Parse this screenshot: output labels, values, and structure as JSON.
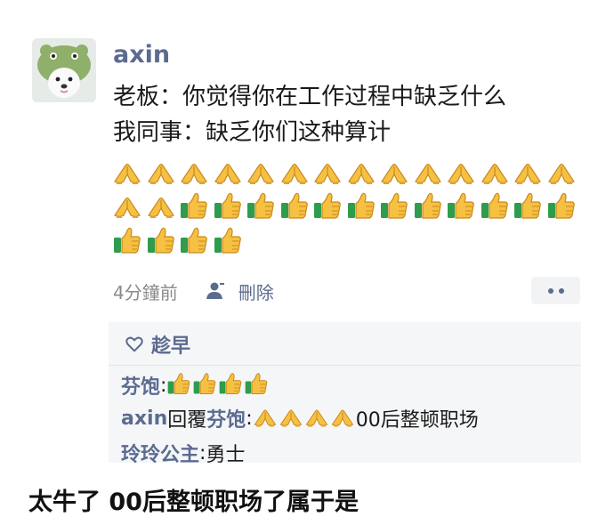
{
  "post": {
    "author": "axin",
    "lines": [
      "老板：你觉得你在工作过程中缺乏什么",
      "我同事：缺乏你们这种算计"
    ],
    "emoji_rows": [
      [
        "folded-hands-emoji",
        "folded-hands-emoji",
        "folded-hands-emoji",
        "folded-hands-emoji",
        "folded-hands-emoji",
        "folded-hands-emoji",
        "folded-hands-emoji",
        "folded-hands-emoji",
        "folded-hands-emoji",
        "folded-hands-emoji",
        "folded-hands-emoji",
        "folded-hands-emoji",
        "folded-hands-emoji",
        "folded-hands-emoji"
      ],
      [
        "folded-hands-emoji",
        "folded-hands-emoji",
        "thumbs-up-emoji",
        "thumbs-up-emoji",
        "thumbs-up-emoji",
        "thumbs-up-emoji",
        "thumbs-up-emoji",
        "thumbs-up-emoji",
        "thumbs-up-emoji",
        "thumbs-up-emoji",
        "thumbs-up-emoji",
        "thumbs-up-emoji",
        "thumbs-up-emoji",
        "thumbs-up-emoji"
      ],
      [
        "thumbs-up-emoji",
        "thumbs-up-emoji",
        "thumbs-up-emoji",
        "thumbs-up-emoji"
      ]
    ],
    "time": "4分鐘前",
    "delete_label": "刪除"
  },
  "likes": {
    "name": "趁早"
  },
  "comments": [
    {
      "name": "芬饱",
      "colon": ":",
      "emojis": [
        "thumbs-up-emoji",
        "thumbs-up-emoji",
        "thumbs-up-emoji",
        "thumbs-up-emoji"
      ],
      "text": ""
    },
    {
      "name": "axin",
      "reply_word": "回覆",
      "reply_to": "芬饱",
      "colon": ":",
      "emojis": [
        "folded-hands-emoji",
        "folded-hands-emoji",
        "folded-hands-emoji",
        "folded-hands-emoji"
      ],
      "text": "00后整顿职场"
    },
    {
      "name": "玲玲公主",
      "colon": ":",
      "emojis": [],
      "text": "勇士"
    }
  ],
  "caption": "太牛了 00后整顿职场了属于是",
  "colors": {
    "name_blue": "#5b6b90",
    "meta_gray": "#8a8a8a",
    "panel_bg": "#f5f6f8"
  }
}
